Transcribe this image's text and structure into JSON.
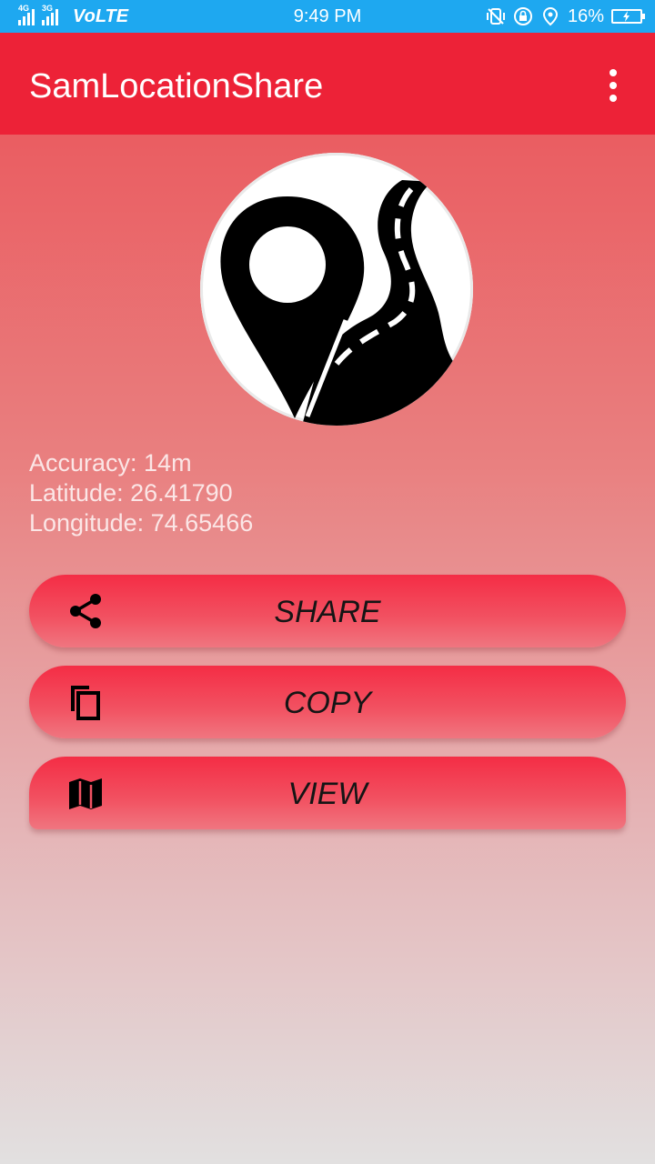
{
  "status_bar": {
    "network_tags": [
      "4G",
      "3G"
    ],
    "volte": "VoLTE",
    "time": "9:49 PM",
    "battery_percent": "16%",
    "icons": [
      "vibrate-icon",
      "rotation-lock-icon",
      "location-icon",
      "battery-charging-icon"
    ]
  },
  "app_bar": {
    "title": "SamLocationShare",
    "menu_icon": "more-vert-icon"
  },
  "location": {
    "accuracy": "Accuracy: 14m",
    "latitude": "Latitude: 26.41790",
    "longitude": "Longitude: 74.65466"
  },
  "buttons": {
    "share": {
      "label": "SHARE",
      "icon": "share-icon"
    },
    "copy": {
      "label": "COPY",
      "icon": "copy-icon"
    },
    "view": {
      "label": "VIEW",
      "icon": "map-icon"
    }
  },
  "colors": {
    "status_bar": "#1ea8f0",
    "app_bar": "#ed2237",
    "button": "#f42d45"
  }
}
